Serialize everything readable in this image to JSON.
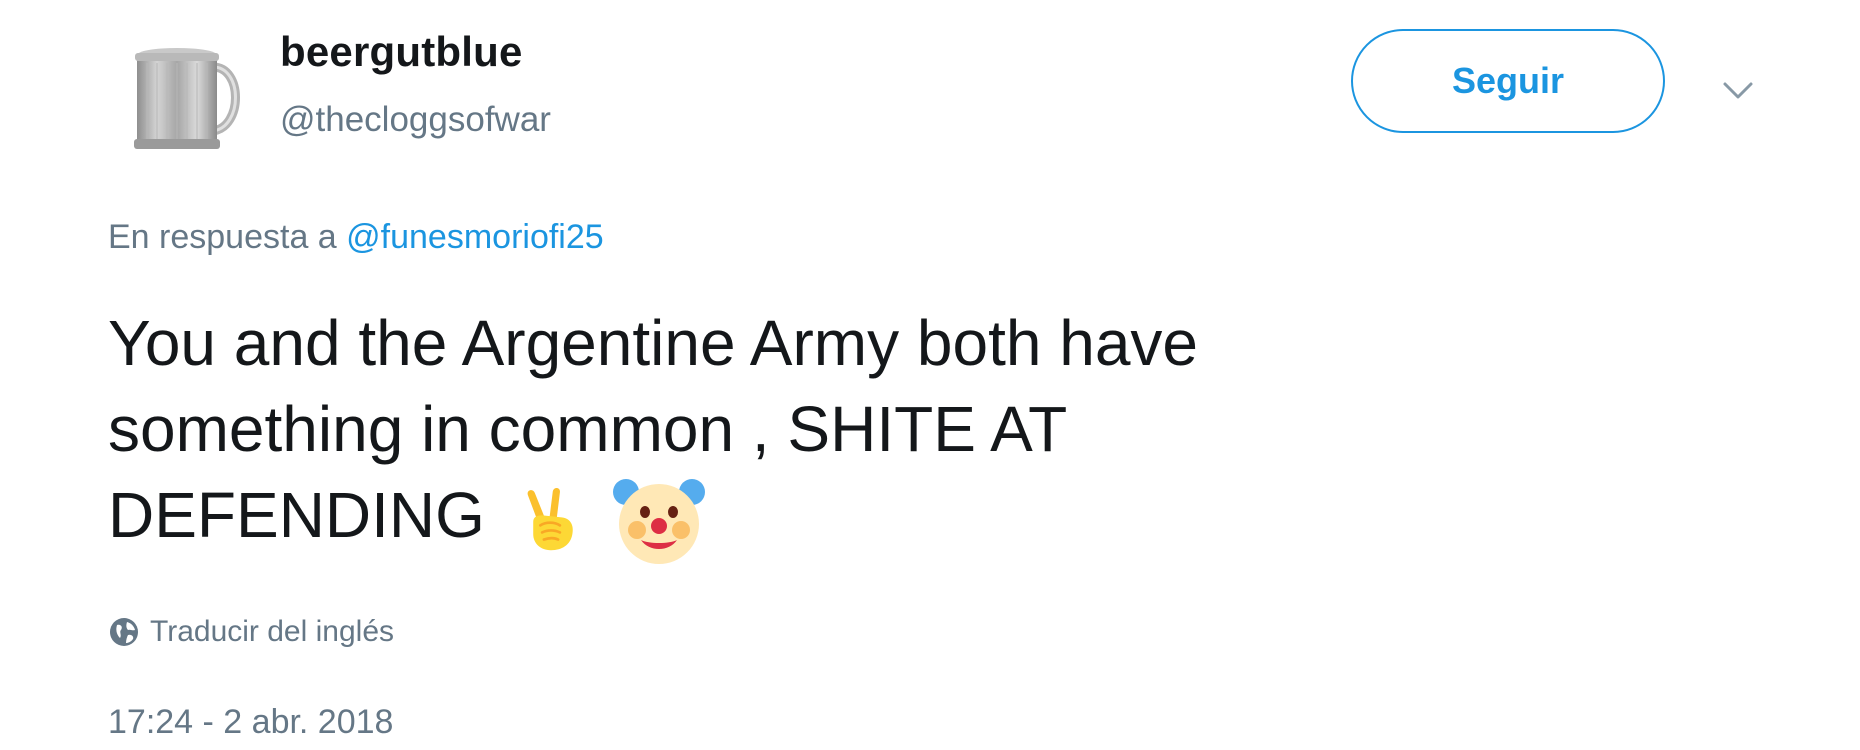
{
  "user": {
    "display_name": "beergutblue",
    "handle": "@thecloggsofwar",
    "avatar_icon": "pewter-tankard-icon"
  },
  "actions": {
    "follow_label": "Seguir",
    "more_icon": "chevron-down-icon"
  },
  "reply": {
    "prefix": "En respuesta a",
    "mention": "@funesmoriofi25"
  },
  "tweet": {
    "line1": "You and the Argentine Army both have",
    "line2": "something in common , SHITE AT",
    "line3": "DEFENDING",
    "emojis": [
      "victory-hand-emoji",
      "clown-face-emoji"
    ]
  },
  "translate": {
    "icon": "globe-icon",
    "label": "Traducir del inglés"
  },
  "timestamp": "17:24 - 2 abr. 2018",
  "colors": {
    "accent": "#1b95e0",
    "text_primary": "#14171a",
    "text_secondary": "#657786"
  }
}
